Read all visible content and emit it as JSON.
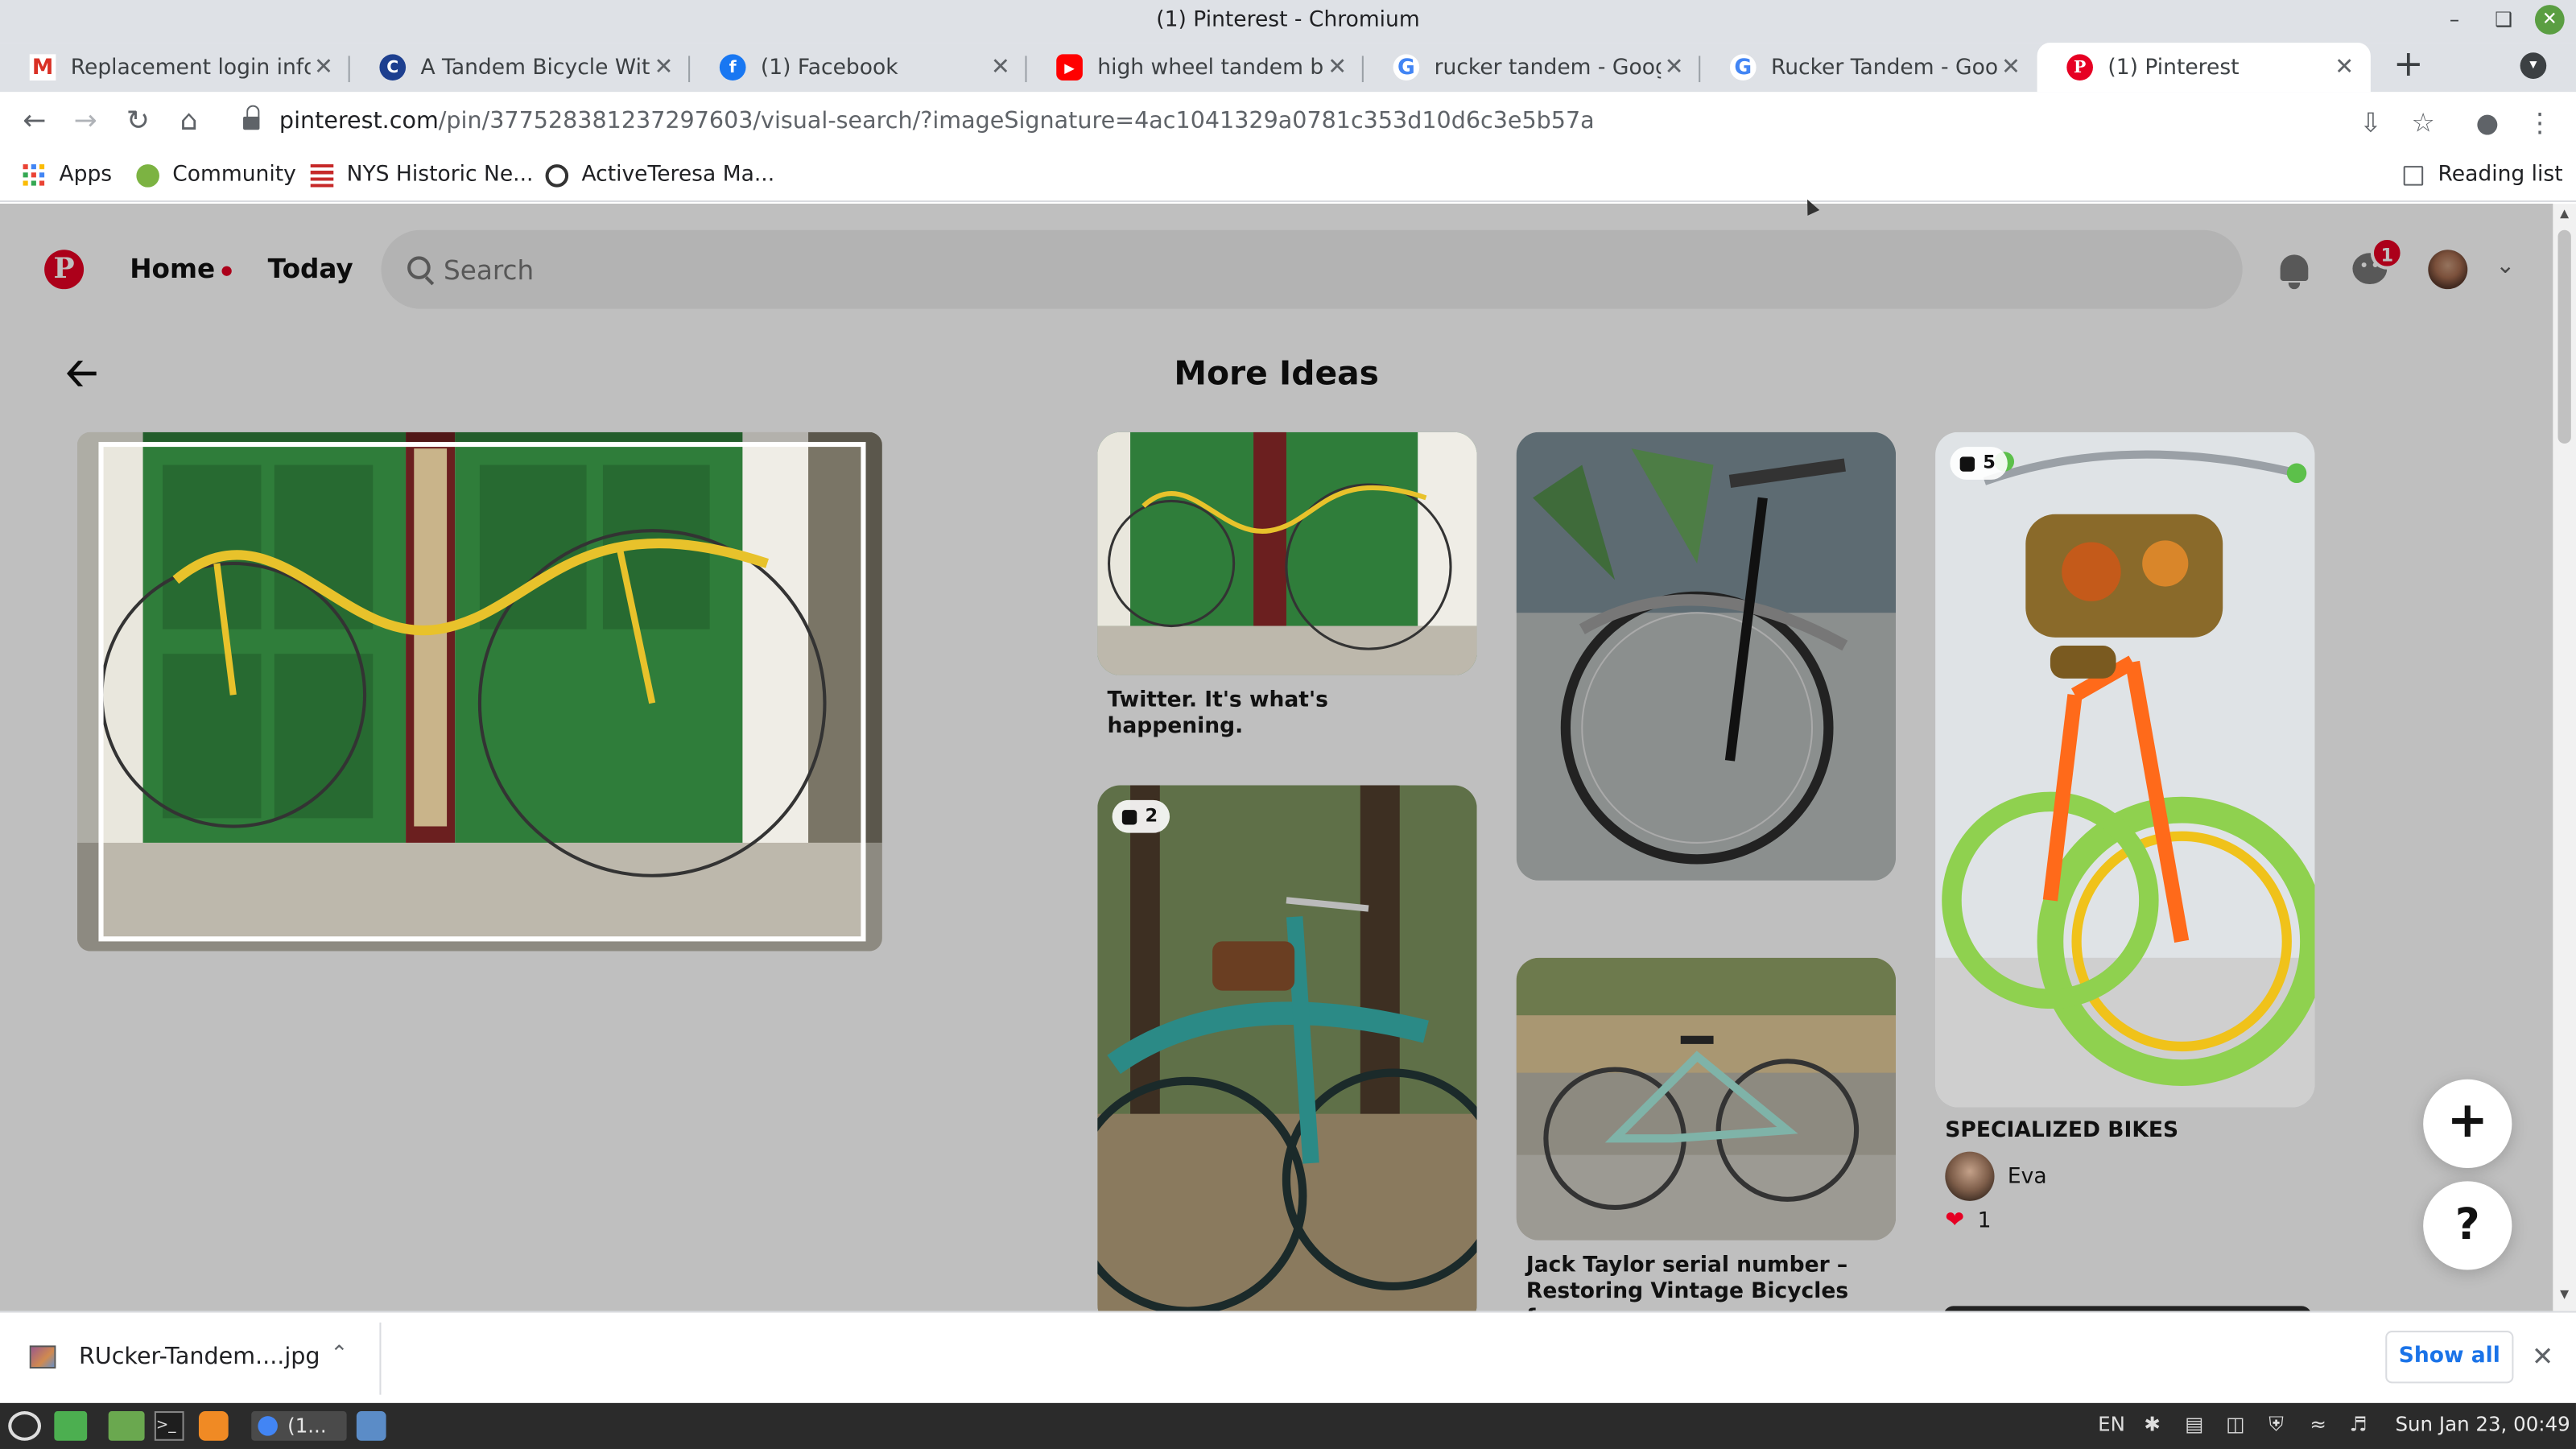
{
  "window": {
    "title": "(1) Pinterest - Chromium"
  },
  "tabs": [
    {
      "label": "Replacement login inform",
      "favicon": "gmail-icon"
    },
    {
      "label": "A Tandem Bicycle Withou",
      "favicon": "site-icon"
    },
    {
      "label": "(1) Facebook",
      "favicon": "facebook-icon"
    },
    {
      "label": "high wheel tandem bicycl",
      "favicon": "youtube-icon"
    },
    {
      "label": "rucker tandem - Google I",
      "favicon": "google-icon"
    },
    {
      "label": "Rucker Tandem - Google",
      "favicon": "google-icon"
    },
    {
      "label": "(1) Pinterest",
      "favicon": "pinterest-icon",
      "active": true
    }
  ],
  "address": {
    "domain": "pinterest.com",
    "path": "/pin/377528381237297603/visual-search/?imageSignature=4ac1041329a0781c353d10d6c3e5b57a"
  },
  "bookmarks": [
    {
      "label": "Apps"
    },
    {
      "label": "Community"
    },
    {
      "label": "NYS Historic Ne..."
    },
    {
      "label": "ActiveTeresa Ma..."
    }
  ],
  "reading_list": "Reading list",
  "pinterest": {
    "logo": "P",
    "nav": {
      "home": "Home",
      "today": "Today"
    },
    "search_placeholder": "Search",
    "message_badge": "1",
    "heading": "More Ideas",
    "pins": [
      {
        "title": "Twitter. It's what's happening."
      },
      {
        "title": ""
      },
      {
        "count": "5",
        "title": "SPECIALIZED BIKES",
        "author": "Eva",
        "reactions": "1"
      },
      {
        "count": "2",
        "title": ""
      },
      {
        "title": "Jack Taylor serial number – Restoring Vintage Bicycles fro..."
      }
    ],
    "fab_add": "+",
    "fab_help": "?"
  },
  "downloads": {
    "file": "RUcker-Tandem....jpg",
    "show_all": "Show all"
  },
  "taskbar": {
    "active_window": "(1...",
    "lang": "EN",
    "clock": "Sun Jan 23, 00:49"
  },
  "colors": {
    "pinterest_red": "#e60023",
    "link_blue": "#1a73e8"
  }
}
